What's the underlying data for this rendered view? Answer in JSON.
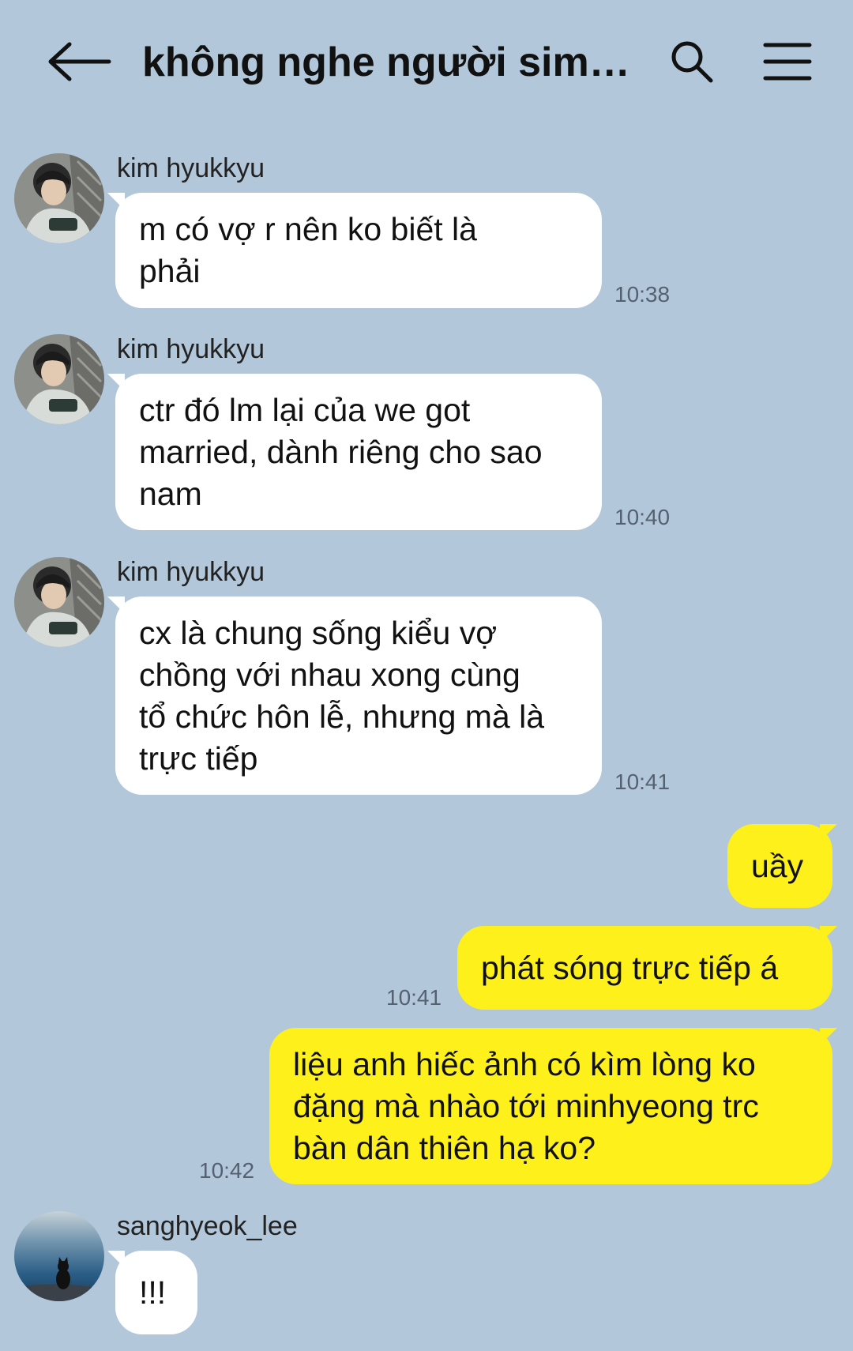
{
  "header": {
    "title": "không nghe người simp...",
    "back_icon": "arrow-left-icon",
    "search_icon": "search-icon",
    "menu_icon": "hamburger-menu-icon"
  },
  "colors": {
    "background": "#b2c7d9",
    "incoming_bubble": "#ffffff",
    "outgoing_bubble": "#fef01b"
  },
  "messages": [
    {
      "direction": "in",
      "sender": "kim hyukkyu",
      "text": "m có vợ r nên ko biết là\nphải",
      "time": "10:38"
    },
    {
      "direction": "in",
      "sender": "kim hyukkyu",
      "text": "ctr đó lm lại của we got\nmarried, dành riêng cho sao\nnam",
      "time": "10:40"
    },
    {
      "direction": "in",
      "sender": "kim hyukkyu",
      "text": "cx là chung sống kiểu vợ\nchồng với nhau xong cùng\ntổ chức hôn lễ, nhưng mà là\ntrực tiếp",
      "time": "10:41"
    },
    {
      "direction": "out",
      "text": "uầy",
      "time": ""
    },
    {
      "direction": "out",
      "text": "phát sóng trực tiếp á",
      "time": "10:41"
    },
    {
      "direction": "out",
      "text": "liệu anh hiếc ảnh có kìm lòng ko\nđặng mà nhào tới minhyeong trc\nbàn dân thiên hạ ko?",
      "time": "10:42"
    },
    {
      "direction": "in",
      "sender": "sanghyeok_lee",
      "text": "!!!",
      "time": ""
    }
  ]
}
